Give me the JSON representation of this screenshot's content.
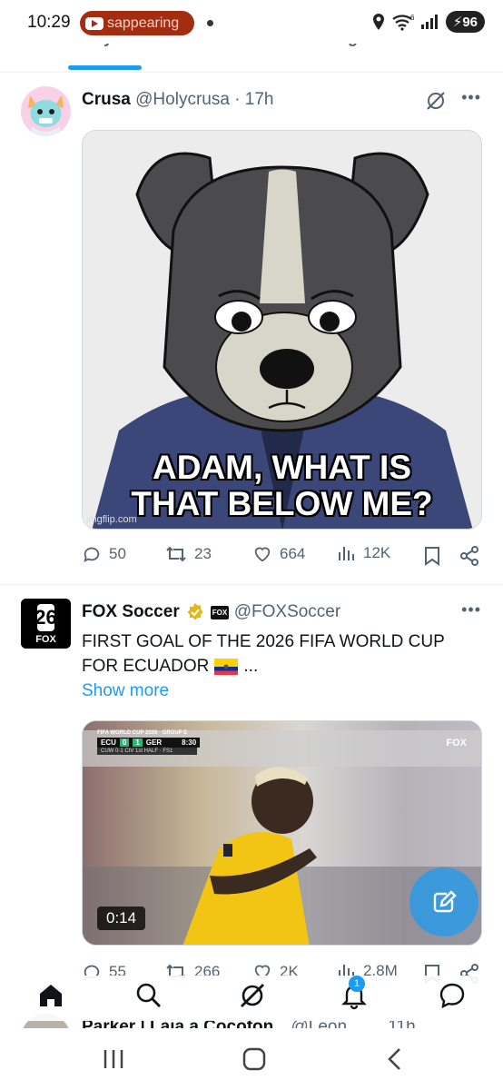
{
  "status_bar": {
    "time": "10:29",
    "notification_text": "sappearing",
    "network": "6",
    "battery": "96"
  },
  "tabs": [
    "For you",
    "Following"
  ],
  "posts": [
    {
      "name": "Crusa",
      "handle": "@Holycrusa",
      "separator": "·",
      "time": "17h",
      "meme_caption_line1": "ADAM, WHAT IS",
      "meme_caption_line2": "THAT BELOW ME?",
      "watermark": "imgflip.com",
      "replies": "50",
      "reposts": "23",
      "likes": "664",
      "views": "12K"
    },
    {
      "name": "FOX Soccer",
      "handle": "@FOXSoccer",
      "avatar_text": "FOX",
      "text_line1": "FIRST GOAL OF THE 2026 FIFA WORLD CUP",
      "text_line2": "FOR ECUADOR",
      "text_suffix": "...",
      "show_more": "Show more",
      "video_time": "0:14",
      "score_title": "FIFA WORLD CUP 2026 · GROUP E",
      "score_home": "ECU",
      "score_home_goals": "0",
      "score_away_goals": "1",
      "score_away": "GER",
      "score_clock": "8:30",
      "score_sub": "CUW 0-1 CIV  1st HALF · FS1",
      "video_watermark": "FOX",
      "replies": "55",
      "reposts": "266",
      "likes": "2K",
      "views": "2.8M"
    },
    {
      "name": "Parker | Laia a Cocofon",
      "handle": "@Leon",
      "time": "11h"
    }
  ],
  "bottom_nav": {
    "notification_badge": "1"
  },
  "colors": {
    "accent": "#1d9bf0",
    "text_secondary": "#536471",
    "notification_pill": "#a32d10"
  }
}
